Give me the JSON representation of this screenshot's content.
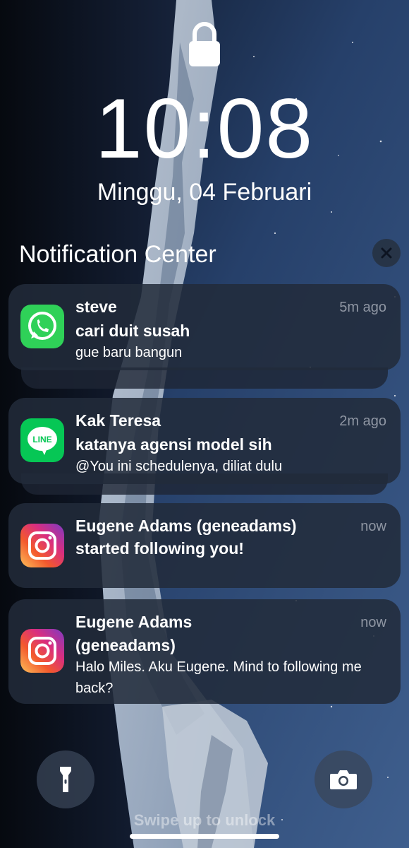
{
  "lock_screen": {
    "lock_icon": "padlock-icon",
    "time": "10:08",
    "date": "Minggu, 04 Februari"
  },
  "notification_center": {
    "title": "Notification Center",
    "close_icon": "close-icon"
  },
  "notifications": [
    {
      "app_icon": "whatsapp-icon",
      "sender": "steve",
      "time": "5m ago",
      "title": "cari duit susah",
      "body": "gue baru bangun",
      "stacked": true
    },
    {
      "app_icon": "line-icon",
      "icon_text": "LINE",
      "sender": "Kak Teresa",
      "time": "2m ago",
      "title": "katanya agensi model sih",
      "body": "@You ini schedulenya, diliat dulu",
      "stacked": true
    },
    {
      "app_icon": "instagram-icon",
      "sender": "Eugene Adams (geneadams)",
      "time": "now",
      "title": "started following you!",
      "body": "",
      "stacked": false
    },
    {
      "app_icon": "instagram-icon",
      "sender": "Eugene Adams",
      "time": "now",
      "title": "(geneadams)",
      "body": "Halo Miles. Aku Eugene. Mind to following me back?",
      "stacked": false
    }
  ],
  "bottom_controls": {
    "left_button_icon": "flashlight-icon",
    "right_button_icon": "camera-icon",
    "swipe_hint": "Swipe up to unlock"
  },
  "colors": {
    "card_background": "#222b3a",
    "secondary_text": "#8f96a3",
    "whatsapp_green": "#2fd158",
    "line_green": "#06c755"
  }
}
